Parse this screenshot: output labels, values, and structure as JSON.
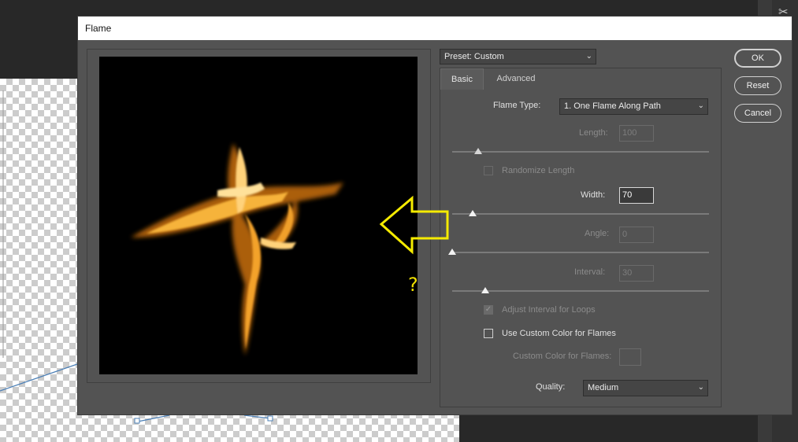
{
  "dialog": {
    "title": "Flame",
    "preset": "Preset: Custom",
    "tabs": [
      "Basic",
      "Advanced"
    ],
    "flame_type_label": "Flame Type:",
    "flame_type_value": "1. One Flame Along Path",
    "length_label": "Length:",
    "length_value": "100",
    "length_slider": 0.1,
    "randomize_length_label": "Randomize Length",
    "width_label": "Width:",
    "width_value": "70",
    "width_slider": 0.08,
    "angle_label": "Angle:",
    "angle_value": "0",
    "angle_slider": 0.0,
    "interval_label": "Interval:",
    "interval_value": "30",
    "interval_slider": 0.13,
    "adjust_interval_label": "Adjust Interval for Loops",
    "adjust_interval_checked": true,
    "use_custom_color_label": "Use Custom Color for Flames",
    "use_custom_color_checked": false,
    "custom_color_label": "Custom Color for Flames:",
    "quality_label": "Quality:",
    "quality_value": "Medium",
    "buttons": {
      "ok": "OK",
      "reset": "Reset",
      "cancel": "Cancel"
    }
  },
  "annotation": {
    "question_mark": "?",
    "arrow_color": "#f5eb00"
  },
  "colors": {
    "dialog_bg": "#535353",
    "titlebar": "#ffffff",
    "preview_bg": "#000000"
  },
  "icons": {
    "panel_tool": "scissors-icon"
  }
}
